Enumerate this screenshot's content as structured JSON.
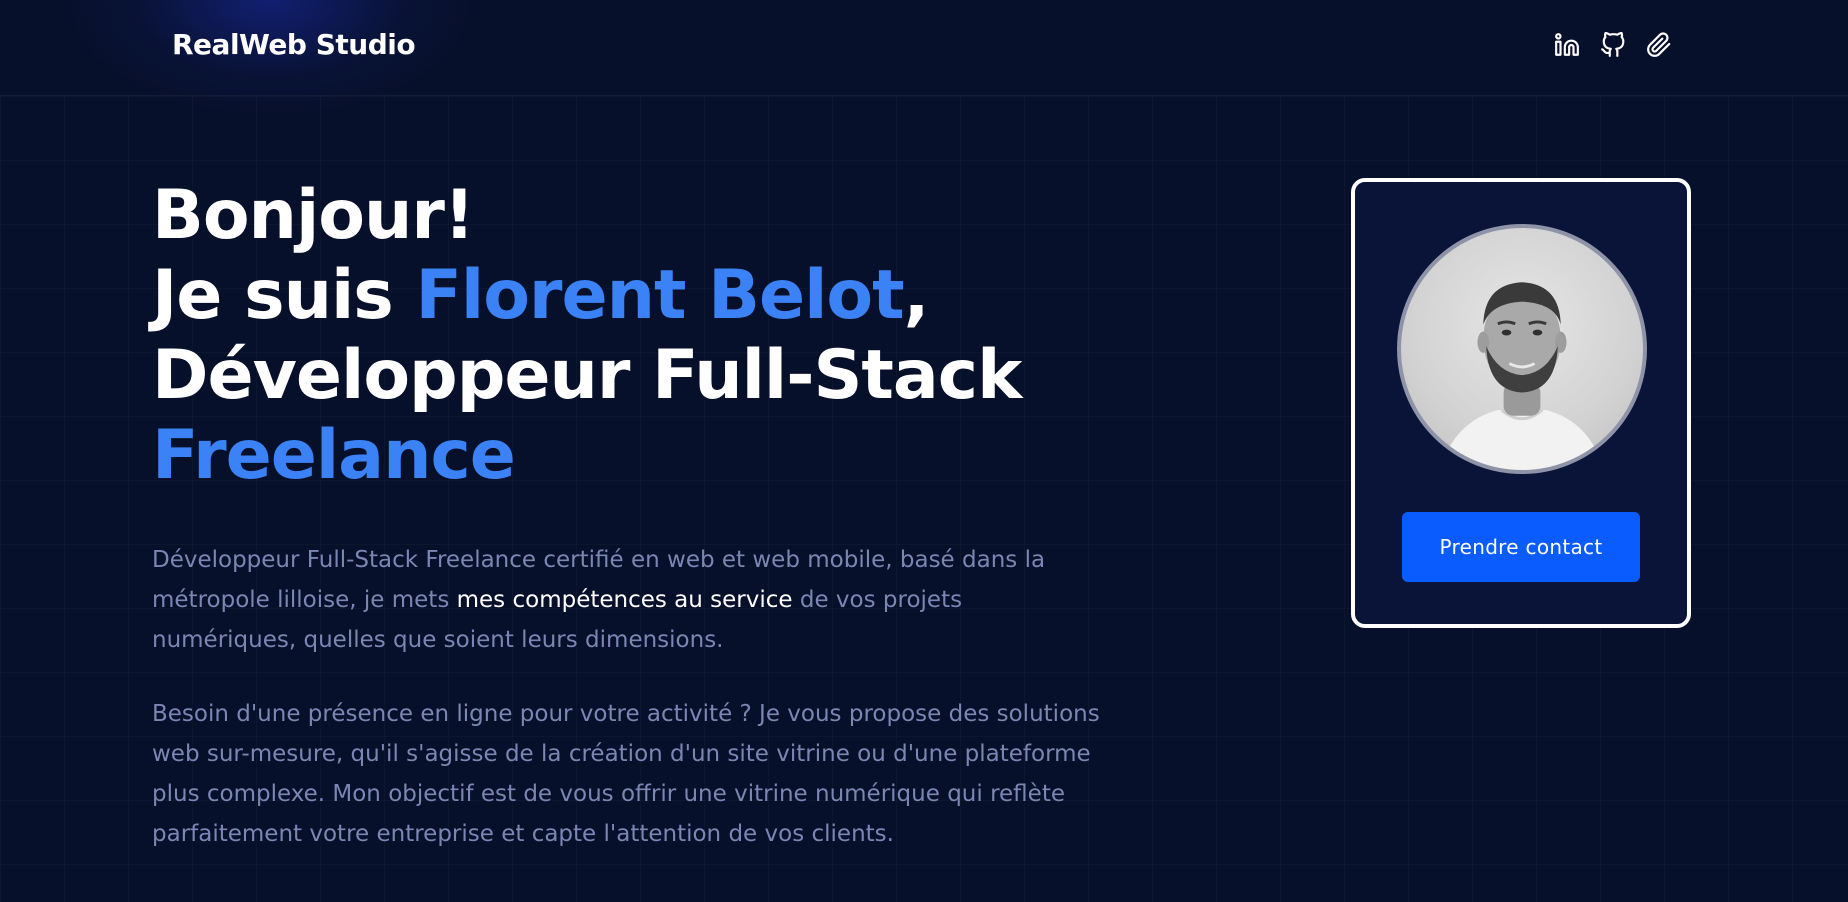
{
  "header": {
    "logo": "RealWeb Studio",
    "social_icons": [
      "linkedin-icon",
      "github-icon",
      "paperclip-icon"
    ]
  },
  "hero": {
    "line1": "Bonjour!",
    "line2_prefix": "Je suis ",
    "name": "Florent Belot",
    "line2_suffix": ",",
    "line3": "Développeur Full-Stack",
    "line4": "Freelance",
    "paragraph1": {
      "before": "Développeur Full-Stack Freelance certifié en web et web mobile, basé dans la métropole lilloise, je mets ",
      "highlight": "mes compétences au service",
      "after": " de vos projets numériques, quelles que soient leurs dimensions."
    },
    "paragraph2": "Besoin d'une présence en ligne pour votre activité ? Je vous propose des solutions web sur-mesure, qu'il s'agisse de la création d'un site vitrine ou d'une plateforme plus complexe. Mon objectif est de vous offrir une vitrine numérique qui reflète parfaitement votre entreprise et capte l'attention de vos clients."
  },
  "card": {
    "cta_label": "Prendre contact"
  },
  "colors": {
    "background": "#07102a",
    "accent": "#3b82f6",
    "button": "#0b5cff",
    "muted_text": "#7c86b3"
  }
}
